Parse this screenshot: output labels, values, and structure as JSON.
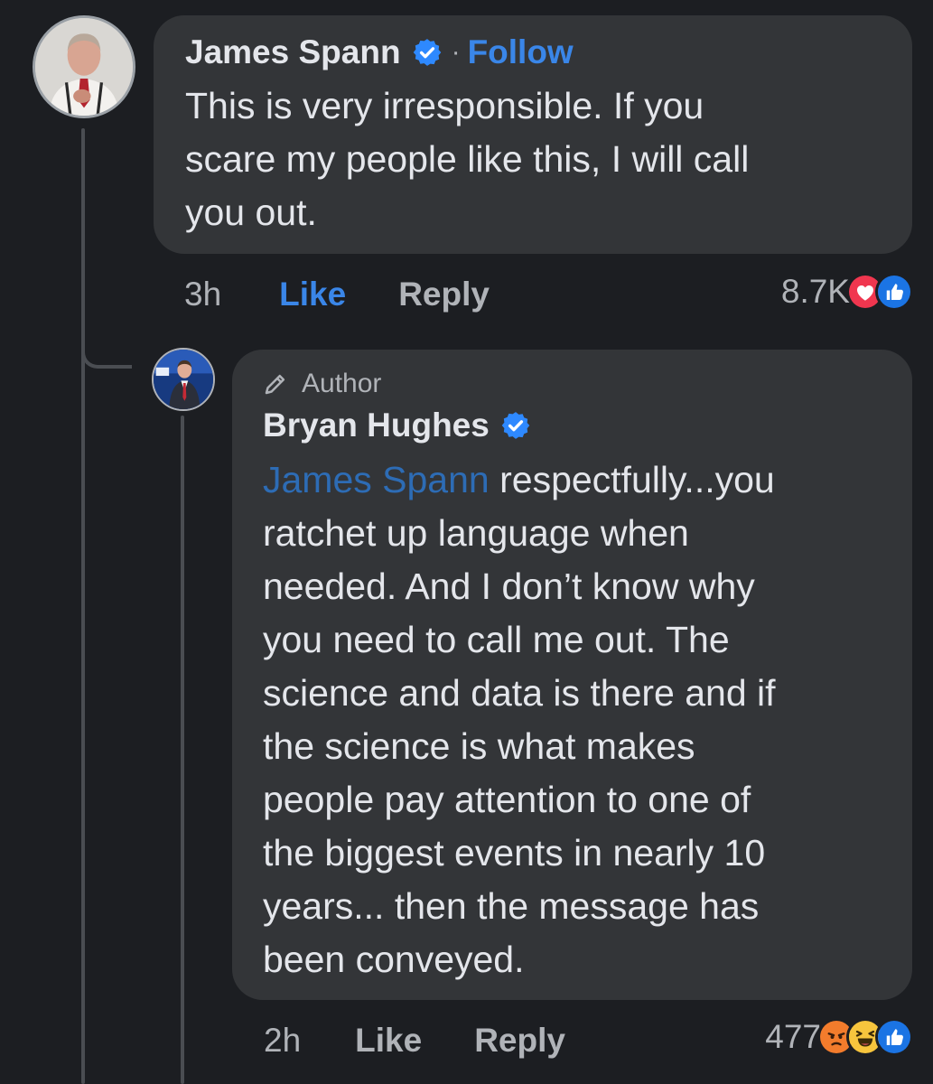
{
  "comments": [
    {
      "name": "James Spann",
      "follow_separator": "·",
      "follow_label": "Follow",
      "lines": [
        "This is very irresponsible. If you",
        "scare my people like this, I will call",
        "you out."
      ],
      "time": "3h",
      "like_label": "Like",
      "reply_label": "Reply",
      "reaction_count": "8.7K",
      "reactions": [
        "love-icon",
        "like-icon"
      ]
    },
    {
      "badge": "Author",
      "name": "Bryan Hughes",
      "mention": "James Spann",
      "first_line_rest": " respectfully...you",
      "lines": [
        "ratchet up language when",
        "needed.  And I don’t know why",
        "you need to call me out.  The",
        "science and data is there and if",
        "the science is what makes",
        "people pay attention to one of",
        "the biggest events in nearly 10",
        "years... then the message has",
        "been conveyed."
      ],
      "time": "2h",
      "like_label": "Like",
      "reply_label": "Reply",
      "reaction_count": "477",
      "reactions": [
        "angry-icon",
        "haha-icon",
        "like-icon"
      ]
    }
  ],
  "colors": {
    "background": "#1c1e22",
    "bubble": "#333538",
    "link_blue": "#3a86e8",
    "mention_blue": "#2d6cb5",
    "verified_blue": "#2e89ff"
  }
}
